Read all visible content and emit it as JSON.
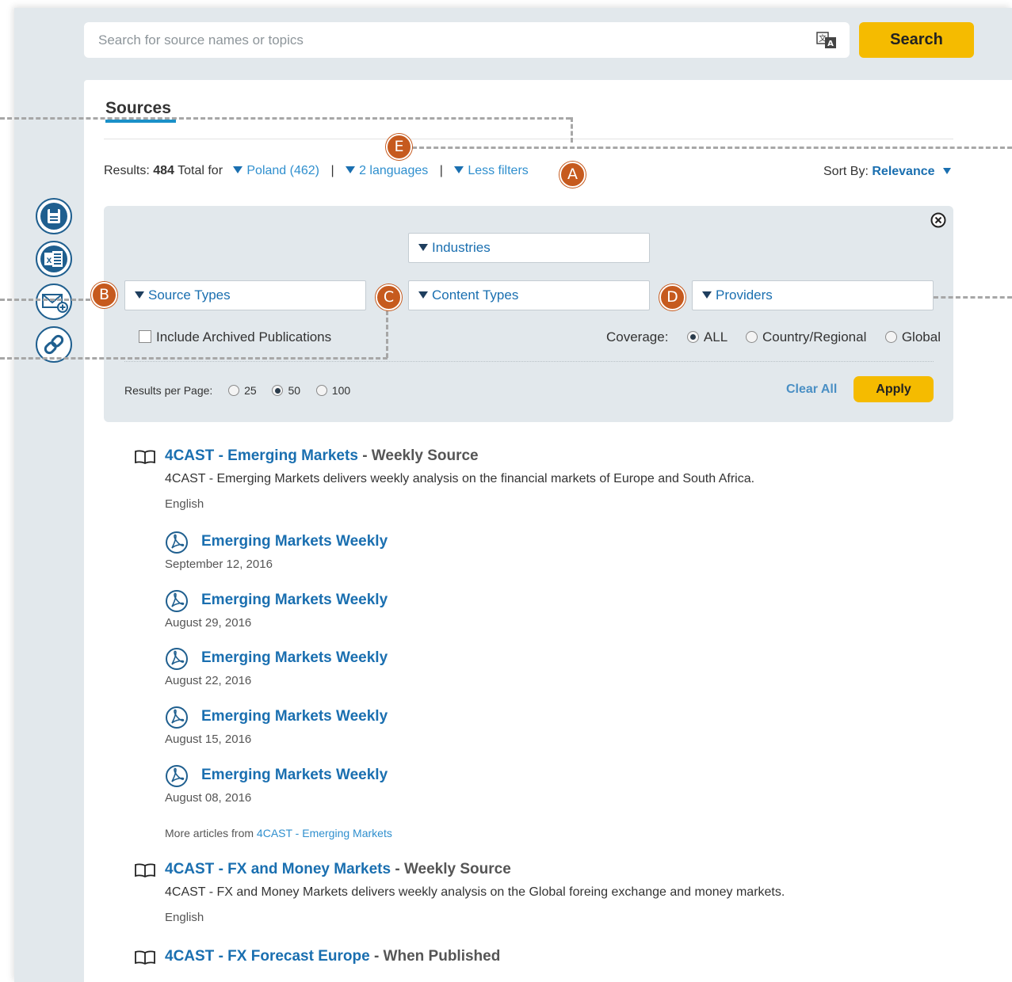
{
  "search": {
    "placeholder": "Search for source names or topics",
    "button_label": "Search"
  },
  "tabs": {
    "sources_label": "Sources"
  },
  "results_bar": {
    "prefix": "Results:",
    "count": "484",
    "suffix": "Total for",
    "region_filter": "Poland (462)",
    "languages_filter": "2 languages",
    "less_filters": "Less filters",
    "separator": "|",
    "sort_label": "Sort By:",
    "sort_value": "Relevance"
  },
  "filters": {
    "industries": "Industries",
    "source_types": "Source Types",
    "content_types": "Content Types",
    "providers": "Providers",
    "include_archived": "Include Archived Publications",
    "coverage_label": "Coverage:",
    "coverage_options": [
      "ALL",
      "Country/Regional",
      "Global"
    ],
    "coverage_selected": "ALL",
    "results_per_page_label": "Results per Page:",
    "results_per_page_options": [
      "25",
      "50",
      "100"
    ],
    "results_per_page_selected": "50",
    "clear_all": "Clear All",
    "apply": "Apply"
  },
  "callouts": [
    "A",
    "B",
    "C",
    "D",
    "E"
  ],
  "sidebar_icons": [
    "save-icon",
    "excel-icon",
    "email-icon",
    "link-icon"
  ],
  "results": [
    {
      "name": "4CAST - Emerging Markets",
      "frequency": "- Weekly Source",
      "description": "4CAST - Emerging Markets delivers weekly analysis on the financial markets of Europe and South Africa.",
      "language": "English"
    },
    {
      "name": "4CAST - FX and Money Markets",
      "frequency": "- Weekly Source",
      "description": "4CAST - FX and Money Markets delivers weekly analysis on the Global foreing exchange and money markets.",
      "language": "English"
    },
    {
      "name": "4CAST - FX Forecast Europe",
      "frequency": "- When Published"
    }
  ],
  "articles": [
    {
      "title": "Emerging Markets Weekly",
      "date": "September 12, 2016"
    },
    {
      "title": "Emerging Markets Weekly",
      "date": "August 29, 2016"
    },
    {
      "title": "Emerging Markets Weekly",
      "date": "August 22, 2016"
    },
    {
      "title": "Emerging Markets Weekly",
      "date": "August 15, 2016"
    },
    {
      "title": "Emerging Markets Weekly",
      "date": "August 08, 2016"
    }
  ],
  "more_articles": {
    "prefix": "More articles from",
    "source": "4CAST - Emerging Markets"
  },
  "colors": {
    "accent_yellow": "#f5bb00",
    "link_blue": "#1a6fb0",
    "callout_orange": "#c65a1e",
    "panel_gray": "#e2e8ec"
  }
}
